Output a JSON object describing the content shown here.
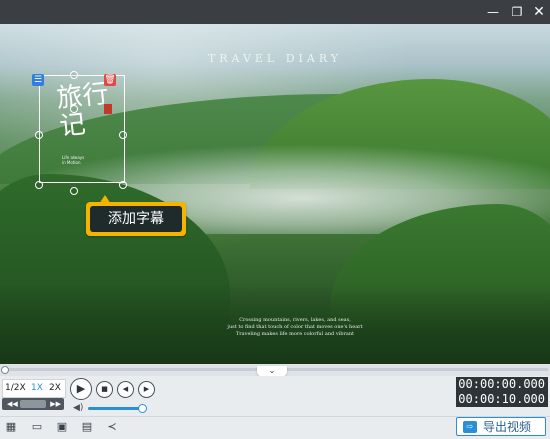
{
  "window": {
    "minimize_glyph": "—",
    "maximize_glyph": "❐",
    "close_glyph": "✕"
  },
  "preview": {
    "title": "TRAVEL   DIARY",
    "caption_lines": [
      "Crossing mountains, rivers, lakes, and seas,",
      "just to find that touch of color that moves one's heart",
      "Traveling makes life more colorful and vibrant"
    ],
    "text_element": {
      "main_text": "旅行记",
      "sub_text": "Life always\nin Motion"
    },
    "tooltip_text": "添加字幕"
  },
  "playback": {
    "speed_options": [
      "1/2X",
      "1X",
      "2X"
    ],
    "selected_speed": "1X",
    "current_time": "00:00:00.000",
    "total_time": "00:00:10.000",
    "progress": 0.0,
    "volume": 0.95
  },
  "toolbar": {
    "export_label": "导出视频"
  },
  "colors": {
    "accent": "#2b8fd8",
    "tooltip_border": "#f4b400",
    "delete_red": "#e04848"
  }
}
